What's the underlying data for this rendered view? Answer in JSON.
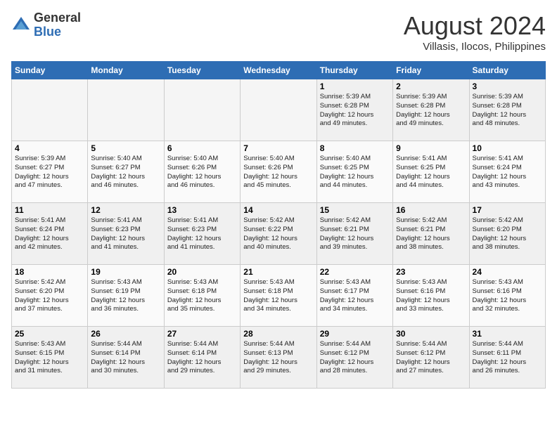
{
  "logo": {
    "general": "General",
    "blue": "Blue"
  },
  "title": "August 2024",
  "location": "Villasis, Ilocos, Philippines",
  "days_of_week": [
    "Sunday",
    "Monday",
    "Tuesday",
    "Wednesday",
    "Thursday",
    "Friday",
    "Saturday"
  ],
  "weeks": [
    [
      {
        "day": "",
        "info": ""
      },
      {
        "day": "",
        "info": ""
      },
      {
        "day": "",
        "info": ""
      },
      {
        "day": "",
        "info": ""
      },
      {
        "day": "1",
        "info": "Sunrise: 5:39 AM\nSunset: 6:28 PM\nDaylight: 12 hours\nand 49 minutes."
      },
      {
        "day": "2",
        "info": "Sunrise: 5:39 AM\nSunset: 6:28 PM\nDaylight: 12 hours\nand 49 minutes."
      },
      {
        "day": "3",
        "info": "Sunrise: 5:39 AM\nSunset: 6:28 PM\nDaylight: 12 hours\nand 48 minutes."
      }
    ],
    [
      {
        "day": "4",
        "info": "Sunrise: 5:39 AM\nSunset: 6:27 PM\nDaylight: 12 hours\nand 47 minutes."
      },
      {
        "day": "5",
        "info": "Sunrise: 5:40 AM\nSunset: 6:27 PM\nDaylight: 12 hours\nand 46 minutes."
      },
      {
        "day": "6",
        "info": "Sunrise: 5:40 AM\nSunset: 6:26 PM\nDaylight: 12 hours\nand 46 minutes."
      },
      {
        "day": "7",
        "info": "Sunrise: 5:40 AM\nSunset: 6:26 PM\nDaylight: 12 hours\nand 45 minutes."
      },
      {
        "day": "8",
        "info": "Sunrise: 5:40 AM\nSunset: 6:25 PM\nDaylight: 12 hours\nand 44 minutes."
      },
      {
        "day": "9",
        "info": "Sunrise: 5:41 AM\nSunset: 6:25 PM\nDaylight: 12 hours\nand 44 minutes."
      },
      {
        "day": "10",
        "info": "Sunrise: 5:41 AM\nSunset: 6:24 PM\nDaylight: 12 hours\nand 43 minutes."
      }
    ],
    [
      {
        "day": "11",
        "info": "Sunrise: 5:41 AM\nSunset: 6:24 PM\nDaylight: 12 hours\nand 42 minutes."
      },
      {
        "day": "12",
        "info": "Sunrise: 5:41 AM\nSunset: 6:23 PM\nDaylight: 12 hours\nand 41 minutes."
      },
      {
        "day": "13",
        "info": "Sunrise: 5:41 AM\nSunset: 6:23 PM\nDaylight: 12 hours\nand 41 minutes."
      },
      {
        "day": "14",
        "info": "Sunrise: 5:42 AM\nSunset: 6:22 PM\nDaylight: 12 hours\nand 40 minutes."
      },
      {
        "day": "15",
        "info": "Sunrise: 5:42 AM\nSunset: 6:21 PM\nDaylight: 12 hours\nand 39 minutes."
      },
      {
        "day": "16",
        "info": "Sunrise: 5:42 AM\nSunset: 6:21 PM\nDaylight: 12 hours\nand 38 minutes."
      },
      {
        "day": "17",
        "info": "Sunrise: 5:42 AM\nSunset: 6:20 PM\nDaylight: 12 hours\nand 38 minutes."
      }
    ],
    [
      {
        "day": "18",
        "info": "Sunrise: 5:42 AM\nSunset: 6:20 PM\nDaylight: 12 hours\nand 37 minutes."
      },
      {
        "day": "19",
        "info": "Sunrise: 5:43 AM\nSunset: 6:19 PM\nDaylight: 12 hours\nand 36 minutes."
      },
      {
        "day": "20",
        "info": "Sunrise: 5:43 AM\nSunset: 6:18 PM\nDaylight: 12 hours\nand 35 minutes."
      },
      {
        "day": "21",
        "info": "Sunrise: 5:43 AM\nSunset: 6:18 PM\nDaylight: 12 hours\nand 34 minutes."
      },
      {
        "day": "22",
        "info": "Sunrise: 5:43 AM\nSunset: 6:17 PM\nDaylight: 12 hours\nand 34 minutes."
      },
      {
        "day": "23",
        "info": "Sunrise: 5:43 AM\nSunset: 6:16 PM\nDaylight: 12 hours\nand 33 minutes."
      },
      {
        "day": "24",
        "info": "Sunrise: 5:43 AM\nSunset: 6:16 PM\nDaylight: 12 hours\nand 32 minutes."
      }
    ],
    [
      {
        "day": "25",
        "info": "Sunrise: 5:43 AM\nSunset: 6:15 PM\nDaylight: 12 hours\nand 31 minutes."
      },
      {
        "day": "26",
        "info": "Sunrise: 5:44 AM\nSunset: 6:14 PM\nDaylight: 12 hours\nand 30 minutes."
      },
      {
        "day": "27",
        "info": "Sunrise: 5:44 AM\nSunset: 6:14 PM\nDaylight: 12 hours\nand 29 minutes."
      },
      {
        "day": "28",
        "info": "Sunrise: 5:44 AM\nSunset: 6:13 PM\nDaylight: 12 hours\nand 29 minutes."
      },
      {
        "day": "29",
        "info": "Sunrise: 5:44 AM\nSunset: 6:12 PM\nDaylight: 12 hours\nand 28 minutes."
      },
      {
        "day": "30",
        "info": "Sunrise: 5:44 AM\nSunset: 6:12 PM\nDaylight: 12 hours\nand 27 minutes."
      },
      {
        "day": "31",
        "info": "Sunrise: 5:44 AM\nSunset: 6:11 PM\nDaylight: 12 hours\nand 26 minutes."
      }
    ]
  ]
}
